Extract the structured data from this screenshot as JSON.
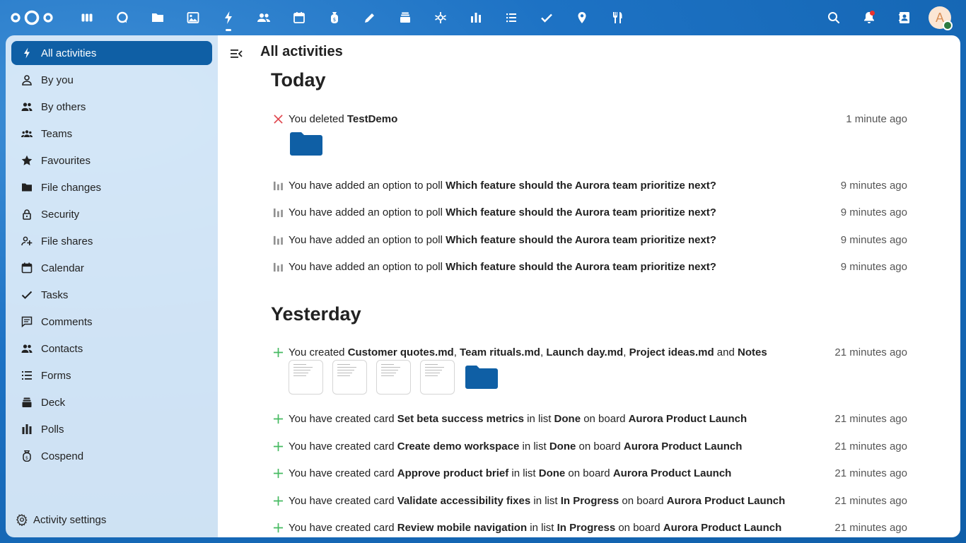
{
  "topbar": {
    "apps": [
      {
        "name": "dashboard-icon"
      },
      {
        "name": "talk-icon"
      },
      {
        "name": "files-icon"
      },
      {
        "name": "photos-icon"
      },
      {
        "name": "activity-icon",
        "active": true
      },
      {
        "name": "contacts-icon"
      },
      {
        "name": "calendar-icon"
      },
      {
        "name": "cospend-icon"
      },
      {
        "name": "notes-icon"
      },
      {
        "name": "deck-icon"
      },
      {
        "name": "whiteboard-icon"
      },
      {
        "name": "polls-icon"
      },
      {
        "name": "forms-icon"
      },
      {
        "name": "tasks-icon"
      },
      {
        "name": "maps-icon"
      },
      {
        "name": "cookbook-icon"
      }
    ],
    "avatar_initial": "A"
  },
  "sidebar": {
    "items": [
      {
        "label": "All activities",
        "icon": "lightning-icon",
        "active": true
      },
      {
        "label": "By you",
        "icon": "user-icon"
      },
      {
        "label": "By others",
        "icon": "users-icon"
      },
      {
        "label": "Teams",
        "icon": "teams-icon"
      },
      {
        "label": "Favourites",
        "icon": "star-icon"
      },
      {
        "label": "File changes",
        "icon": "folder-icon"
      },
      {
        "label": "Security",
        "icon": "lock-icon"
      },
      {
        "label": "File shares",
        "icon": "share-icon"
      },
      {
        "label": "Calendar",
        "icon": "calendar-icon"
      },
      {
        "label": "Tasks",
        "icon": "check-icon"
      },
      {
        "label": "Comments",
        "icon": "comment-icon"
      },
      {
        "label": "Contacts",
        "icon": "contacts-icon"
      },
      {
        "label": "Forms",
        "icon": "list-icon"
      },
      {
        "label": "Deck",
        "icon": "deck-icon"
      },
      {
        "label": "Polls",
        "icon": "poll-icon"
      },
      {
        "label": "Cospend",
        "icon": "cospend-icon"
      }
    ],
    "settings_label": "Activity settings"
  },
  "main": {
    "title": "All activities",
    "sections": [
      {
        "title": "Today",
        "activities": [
          {
            "icon": "delete-icon",
            "parts": [
              [
                "You deleted ",
                false
              ],
              [
                "TestDemo",
                true
              ]
            ],
            "time": "1 minute ago"
          },
          {
            "icon": "poll-icon",
            "parts": [
              [
                "You have added an option to poll ",
                false
              ],
              [
                "Which feature should the Aurora team prioritize next?",
                true
              ]
            ],
            "time": "9 minutes ago"
          },
          {
            "icon": "poll-icon",
            "parts": [
              [
                "You have added an option to poll ",
                false
              ],
              [
                "Which feature should the Aurora team prioritize next?",
                true
              ]
            ],
            "time": "9 minutes ago"
          },
          {
            "icon": "poll-icon",
            "parts": [
              [
                "You have added an option to poll ",
                false
              ],
              [
                "Which feature should the Aurora team prioritize next?",
                true
              ]
            ],
            "time": "9 minutes ago"
          },
          {
            "icon": "poll-icon",
            "parts": [
              [
                "You have added an option to poll ",
                false
              ],
              [
                "Which feature should the Aurora team prioritize next?",
                true
              ]
            ],
            "time": "9 minutes ago"
          }
        ]
      },
      {
        "title": "Yesterday",
        "activities": [
          {
            "icon": "add-icon",
            "parts": [
              [
                "You created ",
                false
              ],
              [
                "Customer quotes.md",
                true
              ],
              [
                ", ",
                false
              ],
              [
                "Team rituals.md",
                true
              ],
              [
                ", ",
                false
              ],
              [
                "Launch day.md",
                true
              ],
              [
                ", ",
                false
              ],
              [
                "Project ideas.md",
                true
              ],
              [
                " and ",
                false
              ],
              [
                "Notes",
                true
              ]
            ],
            "time": "21 minutes ago"
          },
          {
            "icon": "add-icon",
            "parts": [
              [
                "You have created card ",
                false
              ],
              [
                "Set beta success metrics",
                true
              ],
              [
                " in list ",
                false
              ],
              [
                "Done",
                true
              ],
              [
                " on board ",
                false
              ],
              [
                "Aurora Product Launch",
                true
              ]
            ],
            "time": "21 minutes ago"
          },
          {
            "icon": "add-icon",
            "parts": [
              [
                "You have created card ",
                false
              ],
              [
                "Create demo workspace",
                true
              ],
              [
                " in list ",
                false
              ],
              [
                "Done",
                true
              ],
              [
                " on board ",
                false
              ],
              [
                "Aurora Product Launch",
                true
              ]
            ],
            "time": "21 minutes ago"
          },
          {
            "icon": "add-icon",
            "parts": [
              [
                "You have created card ",
                false
              ],
              [
                "Approve product brief",
                true
              ],
              [
                " in list ",
                false
              ],
              [
                "Done",
                true
              ],
              [
                " on board ",
                false
              ],
              [
                "Aurora Product Launch",
                true
              ]
            ],
            "time": "21 minutes ago"
          },
          {
            "icon": "add-icon",
            "parts": [
              [
                "You have created card ",
                false
              ],
              [
                "Validate accessibility fixes",
                true
              ],
              [
                " in list ",
                false
              ],
              [
                "In Progress",
                true
              ],
              [
                " on board ",
                false
              ],
              [
                "Aurora Product Launch",
                true
              ]
            ],
            "time": "21 minutes ago"
          },
          {
            "icon": "add-icon",
            "parts": [
              [
                "You have created card ",
                false
              ],
              [
                "Review mobile navigation",
                true
              ],
              [
                " in list ",
                false
              ],
              [
                "In Progress",
                true
              ],
              [
                " on board ",
                false
              ],
              [
                "Aurora Product Launch",
                true
              ]
            ],
            "time": "21 minutes ago"
          }
        ]
      }
    ]
  },
  "colors": {
    "primary": "#0f5fa5",
    "delete": "#e0484f",
    "add": "#46ba61",
    "folder": "#0f5fa5"
  }
}
